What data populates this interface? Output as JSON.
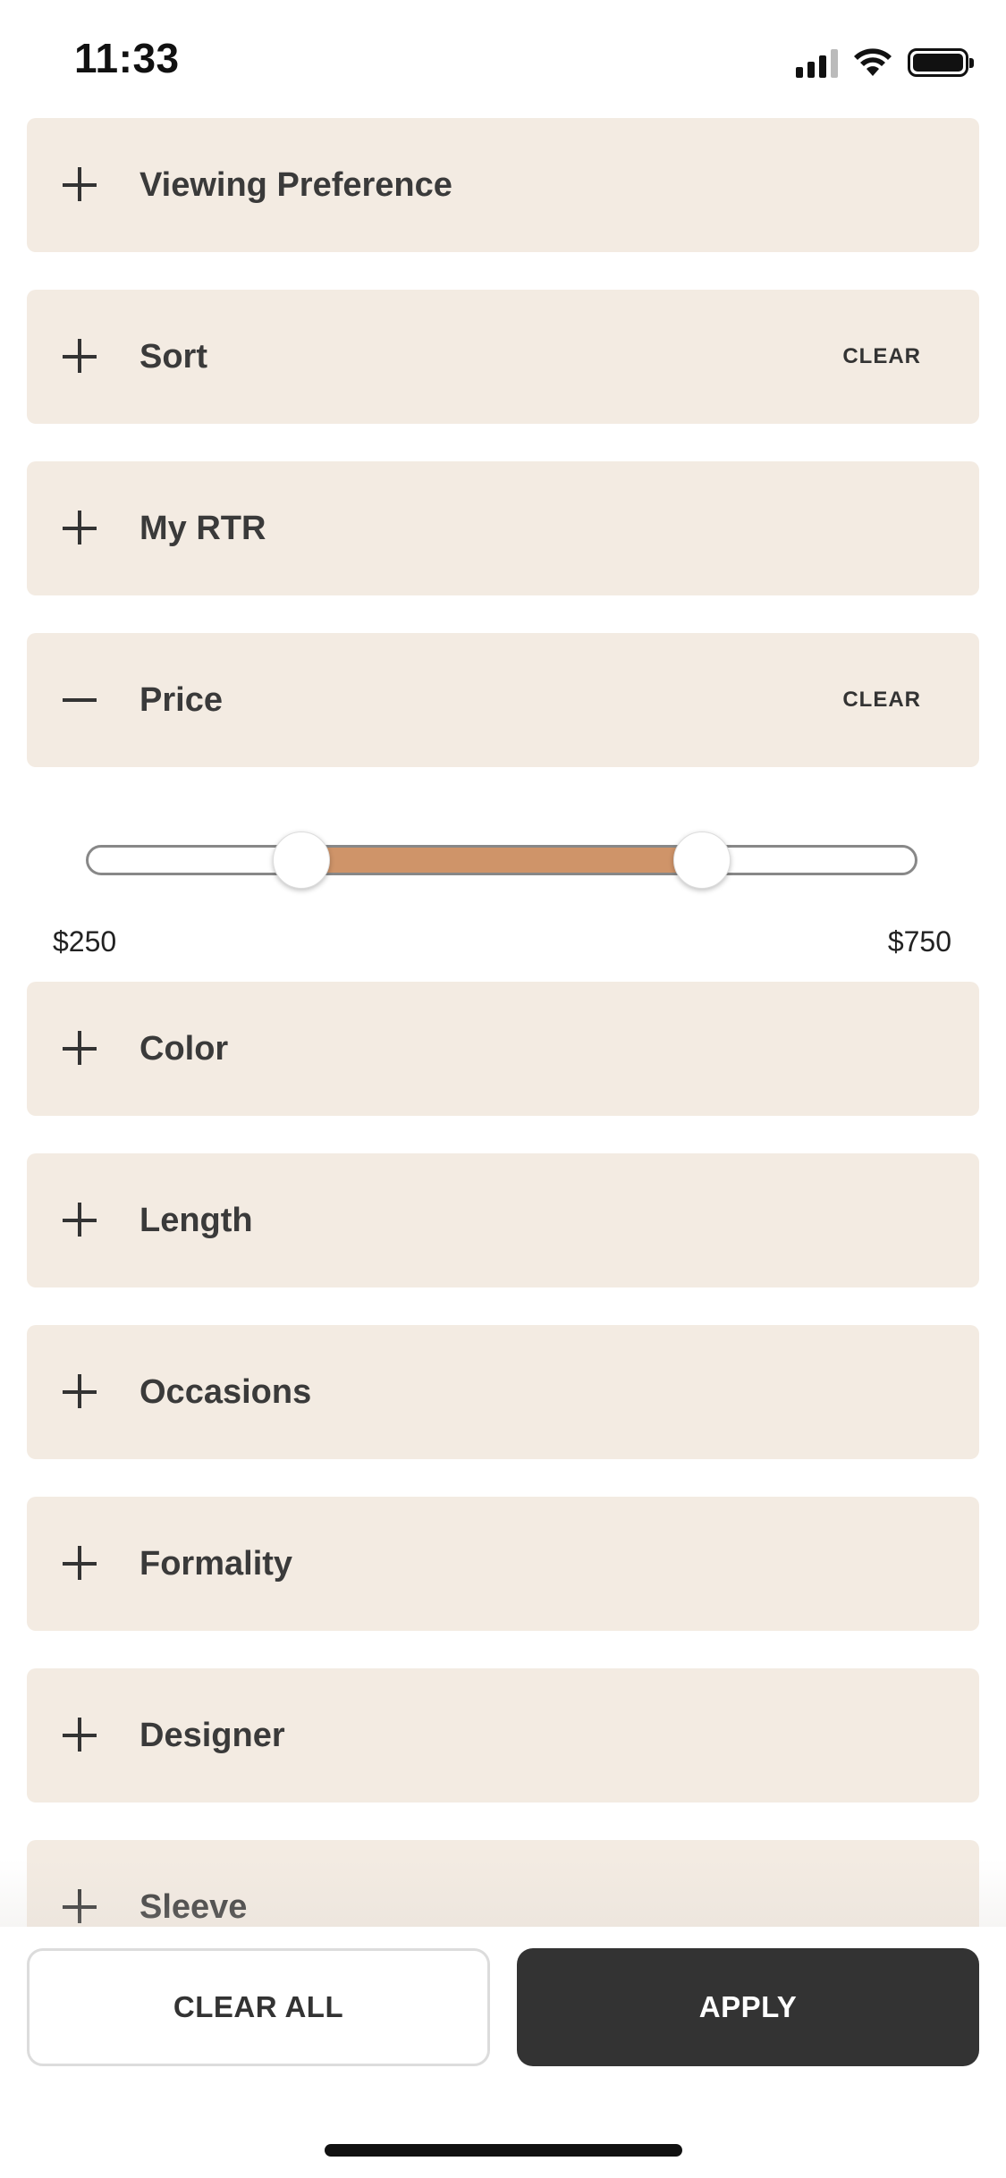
{
  "status_bar": {
    "time": "11:33"
  },
  "sections": [
    {
      "name": "viewing-preference",
      "title": "Viewing Preference",
      "expanded": false,
      "clear_label": ""
    },
    {
      "name": "sort",
      "title": "Sort",
      "expanded": false,
      "clear_label": "CLEAR"
    },
    {
      "name": "my-rtr",
      "title": "My RTR",
      "expanded": false,
      "clear_label": ""
    },
    {
      "name": "price",
      "title": "Price",
      "expanded": true,
      "clear_label": "CLEAR"
    },
    {
      "name": "color",
      "title": "Color",
      "expanded": false,
      "clear_label": ""
    },
    {
      "name": "length",
      "title": "Length",
      "expanded": false,
      "clear_label": ""
    },
    {
      "name": "occasions",
      "title": "Occasions",
      "expanded": false,
      "clear_label": ""
    },
    {
      "name": "formality",
      "title": "Formality",
      "expanded": false,
      "clear_label": ""
    },
    {
      "name": "designer",
      "title": "Designer",
      "expanded": false,
      "clear_label": ""
    },
    {
      "name": "sleeve",
      "title": "Sleeve",
      "expanded": false,
      "clear_label": ""
    }
  ],
  "price_slider": {
    "min_label": "$250",
    "max_label": "$750",
    "low_fraction": 0.25,
    "high_fraction": 0.75,
    "fill_color": "#cf9469"
  },
  "footer": {
    "clear_all_label": "CLEAR ALL",
    "apply_label": "APPLY"
  },
  "colors": {
    "section_bg": "#f3ebe2",
    "apply_bg": "#333333"
  }
}
